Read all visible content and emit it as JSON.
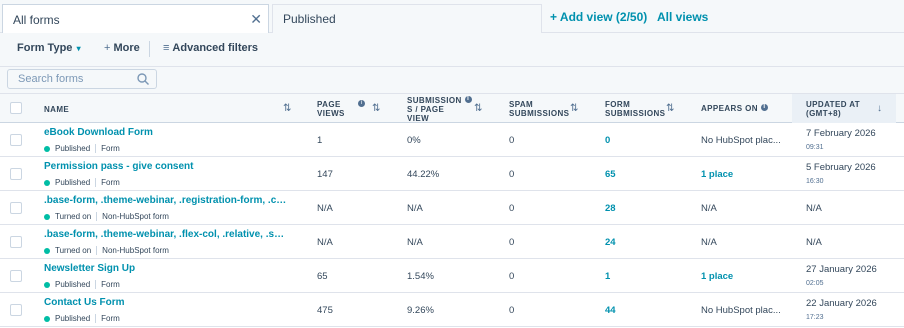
{
  "tabs": {
    "active_label": "All forms",
    "inactive_label": "Published",
    "add_view": "+ Add view (2/50)",
    "all_views": "All views"
  },
  "filters": {
    "form_type": "Form Type",
    "more": "More",
    "advanced": "Advanced filters"
  },
  "search": {
    "placeholder": "Search forms"
  },
  "columns": {
    "name": "NAME",
    "page_views_1": "PAGE",
    "page_views_2": "VIEWS",
    "sub_1": "SUBMISSION",
    "sub_2": "S / PAGE",
    "sub_3": "VIEW",
    "spam_1": "SPAM",
    "spam_2": "SUBMISSIONS",
    "form_1": "FORM",
    "form_2": "SUBMISSIONS",
    "appears": "APPEARS ON",
    "upd_1": "UPDATED AT",
    "upd_2": "(GMT+8)"
  },
  "rows": [
    {
      "name": "eBook Download Form",
      "status": "Published",
      "type": "Form",
      "page_views": "1",
      "rate": "0%",
      "spam": "0",
      "submissions": "0",
      "appears": "No HubSpot plac...",
      "updated": "7 February 2026",
      "time": "09:31"
    },
    {
      "name": "Permission pass - give consent",
      "status": "Published",
      "type": "Form",
      "page_views": "147",
      "rate": "44.22%",
      "spam": "0",
      "submissions": "65",
      "appears": "1 place",
      "updated": "5 February 2026",
      "time": "16:30"
    },
    {
      "name": ".base-form, .theme-webinar, .registration-form, .center-...",
      "status": "Turned on",
      "type": "Non-HubSpot form",
      "page_views": "N/A",
      "rate": "N/A",
      "spam": "0",
      "submissions": "28",
      "appears": "N/A",
      "updated": "N/A",
      "time": ""
    },
    {
      "name": ".base-form, .theme-webinar, .flex-col, .relative, .sm:flex-r...",
      "status": "Turned on",
      "type": "Non-HubSpot form",
      "page_views": "N/A",
      "rate": "N/A",
      "spam": "0",
      "submissions": "24",
      "appears": "N/A",
      "updated": "N/A",
      "time": ""
    },
    {
      "name": "Newsletter Sign Up",
      "status": "Published",
      "type": "Form",
      "page_views": "65",
      "rate": "1.54%",
      "spam": "0",
      "submissions": "1",
      "appears": "1 place",
      "updated": "27 January 2026",
      "time": "02:05"
    },
    {
      "name": "Contact Us Form",
      "status": "Published",
      "type": "Form",
      "page_views": "475",
      "rate": "9.26%",
      "spam": "0",
      "submissions": "44",
      "appears": "No HubSpot plac...",
      "updated": "22 January 2026",
      "time": "17:23"
    }
  ]
}
